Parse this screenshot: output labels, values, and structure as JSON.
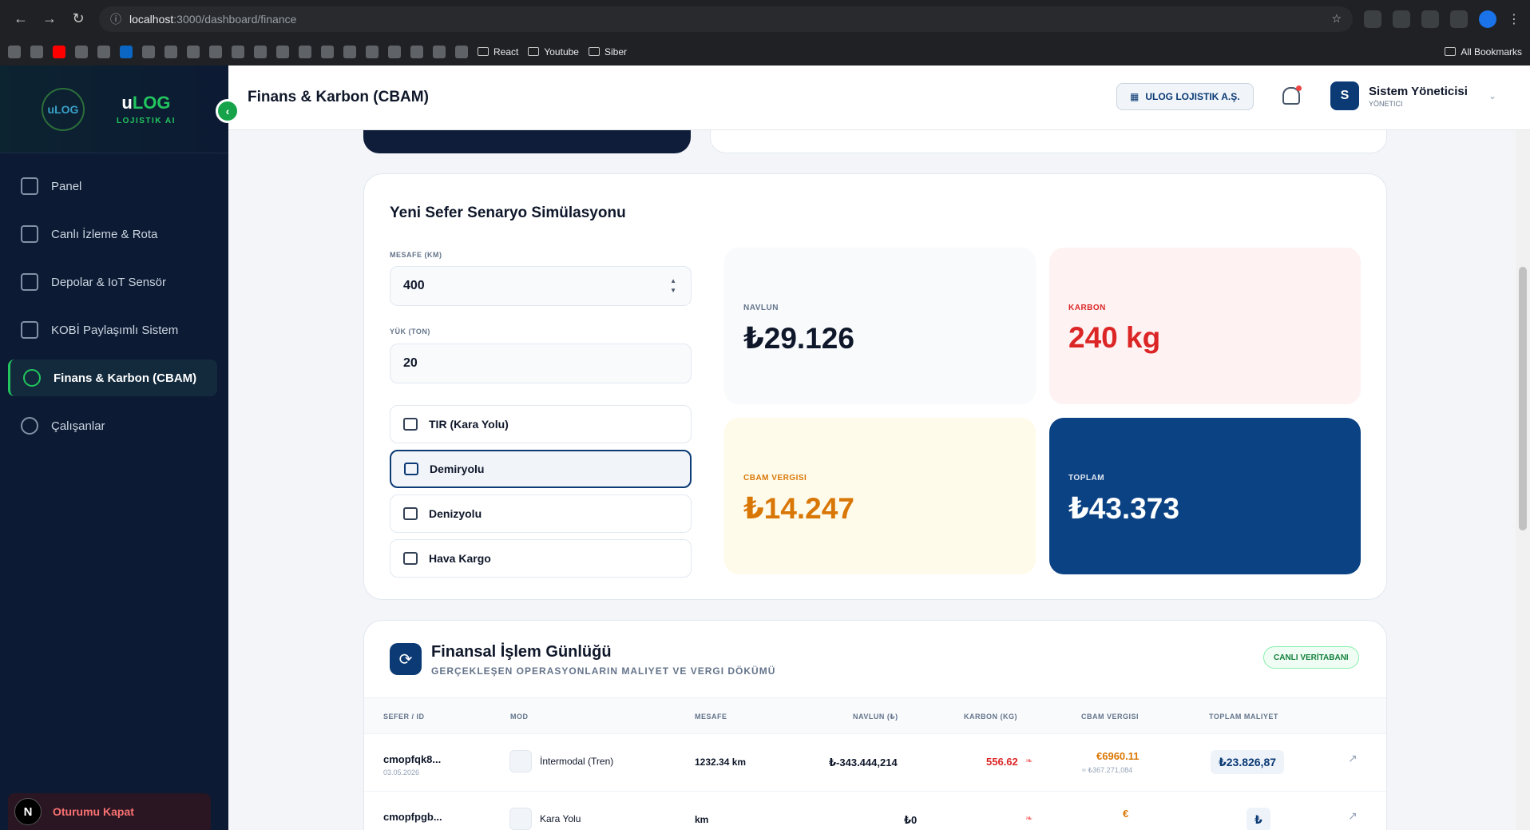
{
  "browser": {
    "url_host": "localhost",
    "url_rest": ":3000/dashboard/finance",
    "bookmarks": [
      "React",
      "Youtube",
      "Siber"
    ],
    "all_bookmarks": "All Bookmarks"
  },
  "sidebar": {
    "brand_u": "u",
    "brand_log": "LOG",
    "brand_sub": "LOJISTIK AI",
    "logo_text": "uLOG",
    "items": [
      {
        "label": "Panel"
      },
      {
        "label": "Canlı İzleme & Rota"
      },
      {
        "label": "Depolar & IoT Sensör"
      },
      {
        "label": "KOBİ Paylaşımlı Sistem"
      },
      {
        "label": "Finans & Karbon (CBAM)"
      },
      {
        "label": "Çalışanlar"
      }
    ],
    "logout": "Oturumu Kapat",
    "n_badge": "N"
  },
  "header": {
    "title": "Finans & Karbon (CBAM)",
    "company": "ULOG LOJISTIK A.Ş.",
    "user_initial": "S",
    "user_name": "Sistem Yöneticisi",
    "user_role": "YÖNETICI"
  },
  "sim": {
    "title": "Yeni Sefer Senaryo Simülasyonu",
    "distance_label": "MESAFE (KM)",
    "distance": "400",
    "load_label": "YÜK (TON)",
    "load": "20",
    "modes": [
      {
        "label": "TIR (Kara Yolu)"
      },
      {
        "label": "Demiryolu"
      },
      {
        "label": "Denizyolu"
      },
      {
        "label": "Hava Kargo"
      }
    ],
    "cards": {
      "navlun_t": "NAVLUN",
      "navlun_v": "₺29.126",
      "karbon_t": "KARBON",
      "karbon_v": "240 kg",
      "cbam_t": "CBAM VERGISI",
      "cbam_v": "₺14.247",
      "toplam_t": "TOPLAM",
      "toplam_v": "₺43.373"
    }
  },
  "log": {
    "title": "Finansal İşlem Günlüğü",
    "subtitle": "GERÇEKLEŞEN OPERASYONLARIN MALIYET VE VERGI DÖKÜMÜ",
    "badge": "CANLI VERİTABANI",
    "headers": [
      "SEFER / ID",
      "MOD",
      "MESAFE",
      "NAVLUN (₺)",
      "KARBON (KG)",
      "CBAM VERGISI",
      "TOPLAM MALIYET"
    ],
    "rows": [
      {
        "id": "cmopfqk8...",
        "date": "03.05.2026",
        "mode": "İntermodal (Tren)",
        "dist": "1232.34 km",
        "navlun": "₺-343.444,214",
        "karbon": "556.62",
        "cbam": "€6960.11",
        "cbam_try": "≈ ₺367.271,084",
        "total": "₺23.826,87"
      },
      {
        "id": "cmopfpgb...",
        "date": "",
        "mode": "Kara Yolu",
        "dist": "km",
        "navlun": "₺0",
        "karbon": "",
        "cbam": "€",
        "cbam_try": "",
        "total": "₺"
      }
    ]
  }
}
